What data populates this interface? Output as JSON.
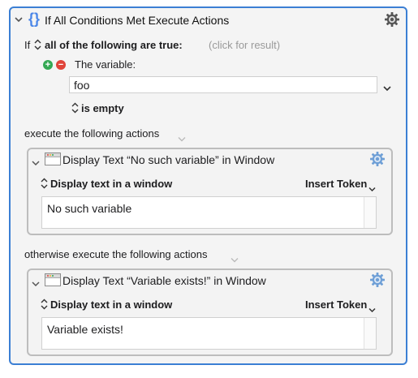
{
  "macro": {
    "title": "If All Conditions Met Execute Actions",
    "if_label": "If",
    "condition_mode": "all of the following are true:",
    "click_for_result": "(click for result)",
    "condition": {
      "type_label": "The variable:",
      "variable_value": "foo",
      "operator": "is empty"
    },
    "execute_label": "execute the following actions",
    "otherwise_label": "otherwise execute the following actions"
  },
  "actions": [
    {
      "title": "Display Text “No such variable” in Window",
      "mode_label": "Display text in a window",
      "insert_token_label": "Insert Token",
      "text": "No such variable"
    },
    {
      "title": "Display Text “Variable exists!” in Window",
      "mode_label": "Display text in a window",
      "insert_token_label": "Insert Token",
      "text": "Variable exists!"
    }
  ],
  "colors": {
    "accent": "#3b7fd4",
    "add_green": "#34a853",
    "remove_red": "#e0443a",
    "gear_blue": "#6e9fd6"
  }
}
